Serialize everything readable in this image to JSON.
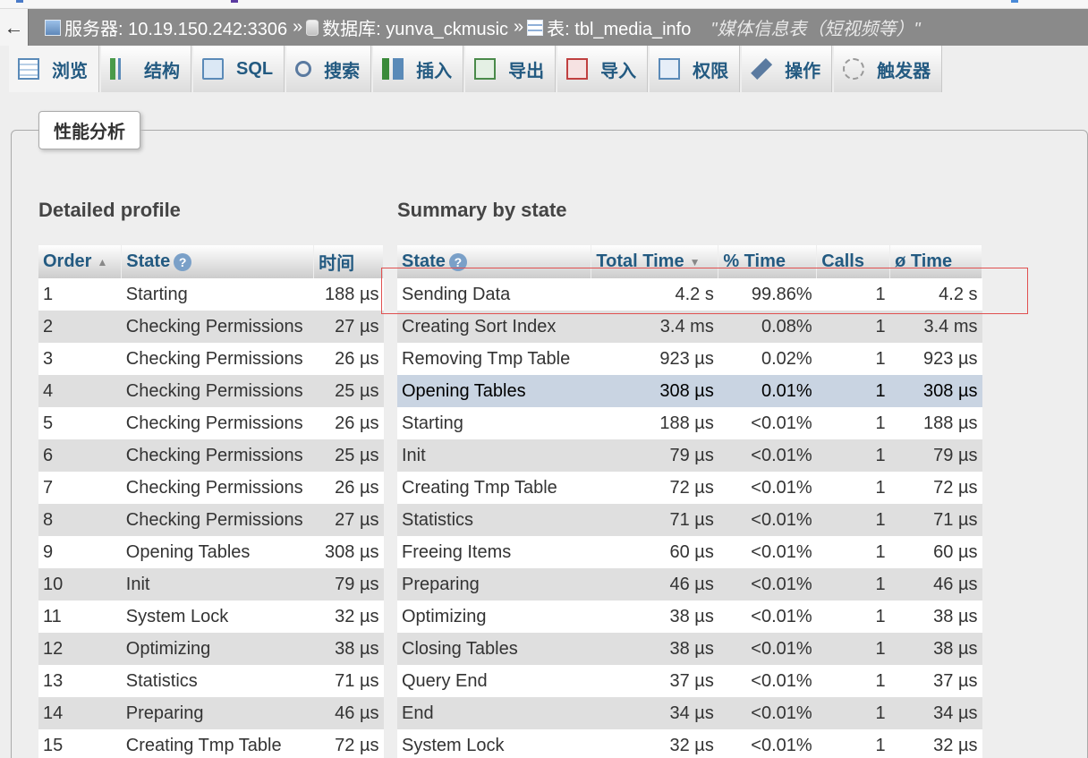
{
  "breadcrumb": {
    "back": "←",
    "server": "服务器: 10.19.150.242:3306",
    "database": "数据库: yunva_ckmusic",
    "table": "表: tbl_media_info",
    "comment": "\"媒体信息表（短视频等）\"",
    "separator": "»"
  },
  "tabs": [
    {
      "label": "浏览"
    },
    {
      "label": "结构"
    },
    {
      "label": "SQL"
    },
    {
      "label": "搜索"
    },
    {
      "label": "插入"
    },
    {
      "label": "导出"
    },
    {
      "label": "导入"
    },
    {
      "label": "权限"
    },
    {
      "label": "操作"
    },
    {
      "label": "触发器"
    }
  ],
  "profiling_button": "性能分析",
  "detailed": {
    "title": "Detailed profile",
    "headers": {
      "order": "Order",
      "state": "State",
      "time": "时间"
    },
    "rows": [
      {
        "order": "1",
        "state": "Starting",
        "time": "188 µs"
      },
      {
        "order": "2",
        "state": "Checking Permissions",
        "time": "27 µs"
      },
      {
        "order": "3",
        "state": "Checking Permissions",
        "time": "26 µs"
      },
      {
        "order": "4",
        "state": "Checking Permissions",
        "time": "25 µs"
      },
      {
        "order": "5",
        "state": "Checking Permissions",
        "time": "26 µs"
      },
      {
        "order": "6",
        "state": "Checking Permissions",
        "time": "25 µs"
      },
      {
        "order": "7",
        "state": "Checking Permissions",
        "time": "26 µs"
      },
      {
        "order": "8",
        "state": "Checking Permissions",
        "time": "27 µs"
      },
      {
        "order": "9",
        "state": "Opening Tables",
        "time": "308 µs"
      },
      {
        "order": "10",
        "state": "Init",
        "time": "79 µs"
      },
      {
        "order": "11",
        "state": "System Lock",
        "time": "32 µs"
      },
      {
        "order": "12",
        "state": "Optimizing",
        "time": "38 µs"
      },
      {
        "order": "13",
        "state": "Statistics",
        "time": "71 µs"
      },
      {
        "order": "14",
        "state": "Preparing",
        "time": "46 µs"
      },
      {
        "order": "15",
        "state": "Creating Tmp Table",
        "time": "72 µs"
      }
    ]
  },
  "summary": {
    "title": "Summary by state",
    "headers": {
      "state": "State",
      "total": "Total Time",
      "pct": "% Time",
      "calls": "Calls",
      "avg": "ø Time"
    },
    "rows": [
      {
        "state": "Sending Data",
        "total": "4.2 s",
        "pct": "99.86%",
        "calls": "1",
        "avg": "4.2 s"
      },
      {
        "state": "Creating Sort Index",
        "total": "3.4 ms",
        "pct": "0.08%",
        "calls": "1",
        "avg": "3.4 ms"
      },
      {
        "state": "Removing Tmp Table",
        "total": "923 µs",
        "pct": "0.02%",
        "calls": "1",
        "avg": "923 µs"
      },
      {
        "state": "Opening Tables",
        "total": "308 µs",
        "pct": "0.01%",
        "calls": "1",
        "avg": "308 µs"
      },
      {
        "state": "Starting",
        "total": "188 µs",
        "pct": "<0.01%",
        "calls": "1",
        "avg": "188 µs"
      },
      {
        "state": "Init",
        "total": "79 µs",
        "pct": "<0.01%",
        "calls": "1",
        "avg": "79 µs"
      },
      {
        "state": "Creating Tmp Table",
        "total": "72 µs",
        "pct": "<0.01%",
        "calls": "1",
        "avg": "72 µs"
      },
      {
        "state": "Statistics",
        "total": "71 µs",
        "pct": "<0.01%",
        "calls": "1",
        "avg": "71 µs"
      },
      {
        "state": "Freeing Items",
        "total": "60 µs",
        "pct": "<0.01%",
        "calls": "1",
        "avg": "60 µs"
      },
      {
        "state": "Preparing",
        "total": "46 µs",
        "pct": "<0.01%",
        "calls": "1",
        "avg": "46 µs"
      },
      {
        "state": "Optimizing",
        "total": "38 µs",
        "pct": "<0.01%",
        "calls": "1",
        "avg": "38 µs"
      },
      {
        "state": "Closing Tables",
        "total": "38 µs",
        "pct": "<0.01%",
        "calls": "1",
        "avg": "38 µs"
      },
      {
        "state": "Query End",
        "total": "37 µs",
        "pct": "<0.01%",
        "calls": "1",
        "avg": "37 µs"
      },
      {
        "state": "End",
        "total": "34 µs",
        "pct": "<0.01%",
        "calls": "1",
        "avg": "34 µs"
      },
      {
        "state": "System Lock",
        "total": "32 µs",
        "pct": "<0.01%",
        "calls": "1",
        "avg": "32 µs"
      }
    ]
  },
  "colors": {
    "accent": "#235a81",
    "breadcrumb_bg": "#8a8a8a",
    "highlight_row": "#c9d4e2",
    "annotation_box": "#e05050"
  }
}
